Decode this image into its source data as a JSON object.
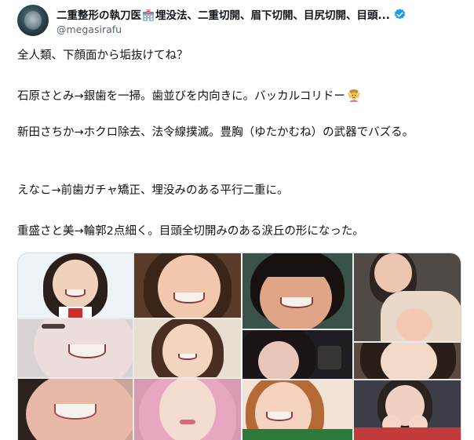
{
  "author": {
    "display_name_part1": "二重整形の執刀医",
    "display_name_part2": "埋没法、二重切開、眉下切開、目尻切開、目頭...",
    "handle": "@megasirafu",
    "hospital_icon": "hospital-emoji-icon",
    "verified_icon": "verified-badge-icon",
    "verified_color": "#1d9bf0"
  },
  "tweet": {
    "line1": "全人類、下顔面から垢抜けてね？",
    "line2": "石原さとみ→銀歯を一掃。歯並びを内向きに。バッカルコリドー",
    "line2_emoji": "person-gesturing-ok-emoji",
    "line3": "新田さちか→ホクロ除去、法令線撲滅。豊胸（ゆたかむね）の武器でバズる。",
    "line4": "えなこ→前歯ガチャ矯正、埋没みのある平行二重に。",
    "line5": "重盛さと美→輪郭2点細く。目頭全切開みのある涙丘の形になった。"
  },
  "media": {
    "image_count": 2,
    "left_image": "before-after-collage-left",
    "right_image": "before-after-collage-right"
  }
}
